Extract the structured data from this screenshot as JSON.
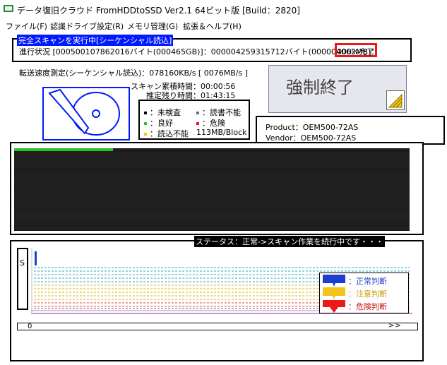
{
  "window": {
    "title": "データ復旧クラウド FromHDDtoSSD Ver2.1 64ビット版 [Build：2820]",
    "icon": "drive-app-icon"
  },
  "menu": {
    "items": [
      {
        "label": "ファイル(F)"
      },
      {
        "label": "認識ドライブ設定(R)"
      },
      {
        "label": "メモリ管理(G)"
      },
      {
        "label": "拡張＆ヘルプ(H)"
      }
    ]
  },
  "scan": {
    "mode": "完全スキャンを実行中[シーケンシャル読込]",
    "progress_text": "進行状況 [000500107862016バイト(000465GB)]：000004259315712バイト(000004062MB)：",
    "percent_text": "000%完了"
  },
  "speed": {
    "text": "転送速度測定(シーケンシャル読込)：078160KB/s [ 0076MB/s ]"
  },
  "time": {
    "elapsed": "スキャン累積時間：00:00:56",
    "remaining": "推定残り時間：01:43:15"
  },
  "legend": {
    "unchecked": "：未検査",
    "read_write_error": "：読書不能",
    "good": "：良好",
    "danger": "：危険",
    "read_error": "：読込不能",
    "block_size": "113MB/Block"
  },
  "stop_button": {
    "label": "強制終了"
  },
  "drive": {
    "product": "Product：OEM500-72AS",
    "vendor": "Vendor：OEM500-72AS"
  },
  "status": {
    "text": "ステータス：正常->スキャン作業を続行中です・・・",
    "s_label": "S"
  },
  "judgement": {
    "normal": "：正常判断",
    "caution": "：注意判断",
    "danger": "：危険判断"
  },
  "navigator": {
    "left": "0",
    "right": ">>"
  },
  "map_data": {
    "progress_fraction": 0.25
  },
  "colors": {
    "accent_blue": "#0019ff",
    "alert_red": "#e81a1a",
    "good_green": "#27c427",
    "caution_yellow": "#f0c419",
    "danger_red": "#e81a1a",
    "map_dark": "#1b1b1b"
  }
}
